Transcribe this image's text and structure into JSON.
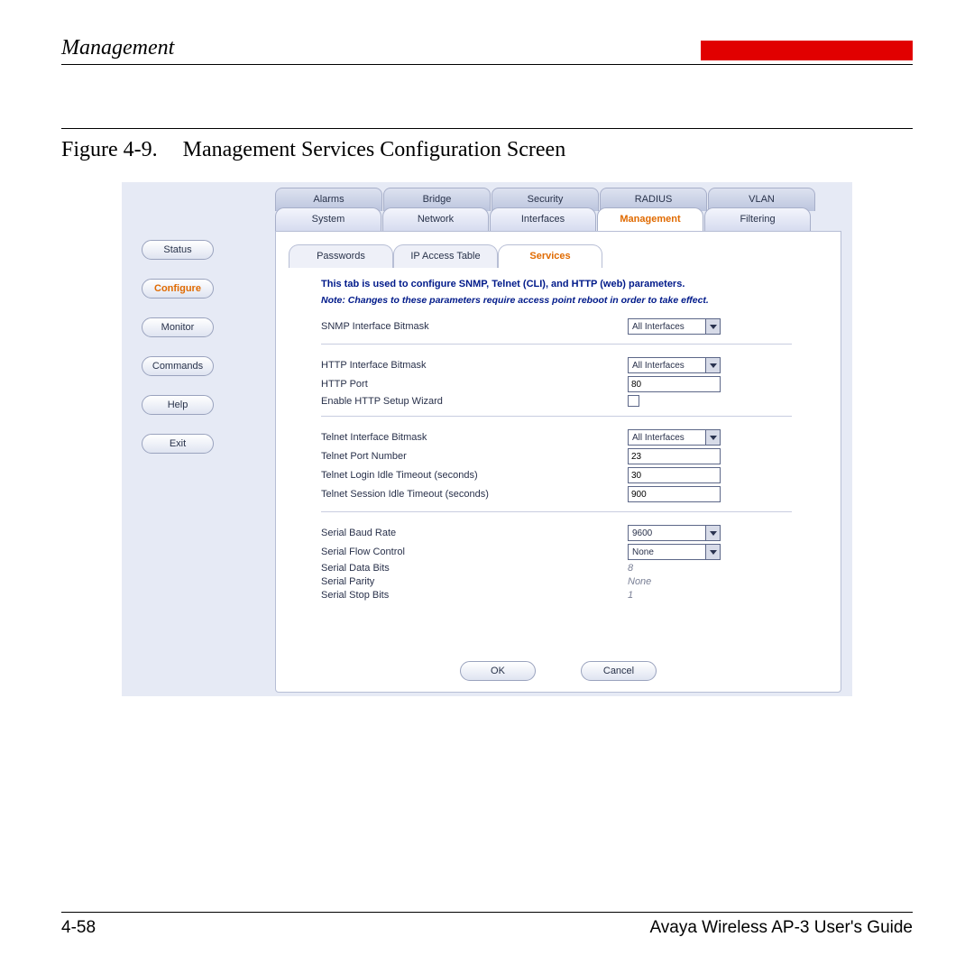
{
  "header": {
    "title": "Management"
  },
  "figure": {
    "label": "Figure 4-9.",
    "title": "Management Services Configuration Screen"
  },
  "sidebar": {
    "items": [
      "Status",
      "Configure",
      "Monitor",
      "Commands",
      "Help",
      "Exit"
    ],
    "active": "Configure"
  },
  "tabs_row1": [
    "Alarms",
    "Bridge",
    "Security",
    "RADIUS",
    "VLAN"
  ],
  "tabs_row2": [
    "System",
    "Network",
    "Interfaces",
    "Management",
    "Filtering"
  ],
  "tabs_row2_active": "Management",
  "subtabs": [
    "Passwords",
    "IP Access Table",
    "Services"
  ],
  "subtabs_active": "Services",
  "intro": "This tab is used to configure SNMP, Telnet (CLI), and HTTP (web) parameters.",
  "note": "Note: Changes to these parameters require access point reboot in order to take effect.",
  "groups": {
    "snmp": {
      "bitmask_label": "SNMP Interface Bitmask",
      "bitmask_value": "All Interfaces"
    },
    "http": {
      "bitmask_label": "HTTP Interface Bitmask",
      "bitmask_value": "All Interfaces",
      "port_label": "HTTP Port",
      "port_value": "80",
      "wizard_label": "Enable HTTP Setup Wizard",
      "wizard_checked": false
    },
    "telnet": {
      "bitmask_label": "Telnet Interface Bitmask",
      "bitmask_value": "All Interfaces",
      "port_label": "Telnet Port Number",
      "port_value": "23",
      "login_label": "Telnet Login Idle Timeout (seconds)",
      "login_value": "30",
      "session_label": "Telnet Session Idle Timeout (seconds)",
      "session_value": "900"
    },
    "serial": {
      "baud_label": "Serial Baud Rate",
      "baud_value": "9600",
      "flow_label": "Serial Flow Control",
      "flow_value": "None",
      "data_label": "Serial Data Bits",
      "data_value": "8",
      "parity_label": "Serial Parity",
      "parity_value": "None",
      "stop_label": "Serial Stop Bits",
      "stop_value": "1"
    }
  },
  "buttons": {
    "ok": "OK",
    "cancel": "Cancel"
  },
  "footer": {
    "page": "4-58",
    "guide": "Avaya Wireless AP-3 User's Guide"
  }
}
